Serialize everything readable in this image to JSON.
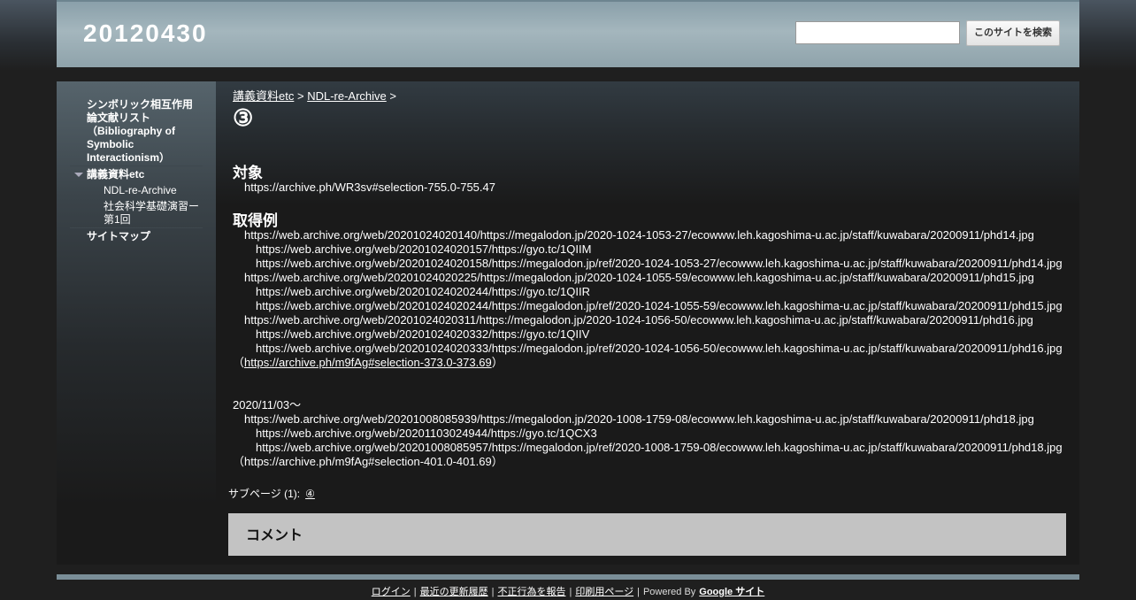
{
  "header": {
    "title": "20120430",
    "search_placeholder": "",
    "search_button": "このサイトを検索"
  },
  "sidebar": {
    "items": [
      {
        "label": "シンボリック相互作用論文献リスト（Bibliography of Symbolic Interactionism）"
      },
      {
        "label": "講義資料etc"
      },
      {
        "label": "NDL-re-Archive"
      },
      {
        "label": "社会科学基礎演習ー第1回"
      },
      {
        "label": "サイトマップ"
      }
    ]
  },
  "main": {
    "breadcrumb": {
      "link1": "講義資料etc",
      "sep1": ">",
      "link2": "NDL-re-Archive",
      "sep2": ">"
    },
    "title": "③",
    "section1": {
      "heading": "対象",
      "line": "https://archive.ph/WR3sv#selection-755.0-755.47"
    },
    "section2": {
      "heading": "取得例",
      "lines": [
        "https://web.archive.org/web/20201024020140/https://megalodon.jp/2020-1024-1053-27/ecowww.leh.kagoshima-u.ac.jp/staff/kuwabara/20200911/phd14.jpg",
        "https://web.archive.org/web/20201024020157/https://gyo.tc/1QIIM",
        "https://web.archive.org/web/20201024020158/https://megalodon.jp/ref/2020-1024-1053-27/ecowww.leh.kagoshima-u.ac.jp/staff/kuwabara/20200911/phd14.jpg",
        "https://web.archive.org/web/20201024020225/https://megalodon.jp/2020-1024-1055-59/ecowww.leh.kagoshima-u.ac.jp/staff/kuwabara/20200911/phd15.jpg",
        "https://web.archive.org/web/20201024020244/https://gyo.tc/1QIIR",
        "https://web.archive.org/web/20201024020244/https://megalodon.jp/ref/2020-1024-1055-59/ecowww.leh.kagoshima-u.ac.jp/staff/kuwabara/20200911/phd15.jpg",
        "https://web.archive.org/web/20201024020311/https://megalodon.jp/2020-1024-1056-50/ecowww.leh.kagoshima-u.ac.jp/staff/kuwabara/20200911/phd16.jpg",
        "https://web.archive.org/web/20201024020332/https://gyo.tc/1QIIV",
        "https://web.archive.org/web/20201024020333/https://megalodon.jp/ref/2020-1024-1056-50/ecowww.leh.kagoshima-u.ac.jp/staff/kuwabara/20200911/phd16.jpg"
      ],
      "source_open": "（",
      "source_link": "https://archive.ph/m9fAg#selection-373.0-373.69",
      "source_close": "）"
    },
    "section3": {
      "date": "2020/11/03～",
      "lines": [
        "https://web.archive.org/web/20201008085939/https://megalodon.jp/2020-1008-1759-08/ecowww.leh.kagoshima-u.ac.jp/staff/kuwabara/20200911/phd18.jpg",
        "https://web.archive.org/web/20201103024944/https://gyo.tc/1QCX3",
        "https://web.archive.org/web/20201008085957/https://megalodon.jp/ref/2020-1008-1759-08/ecowww.leh.kagoshima-u.ac.jp/staff/kuwabara/20200911/phd18.jpg"
      ],
      "source": "（https://archive.ph/m9fAg#selection-401.0-401.69）"
    },
    "subpages": {
      "label": "サブページ (1):",
      "link": "④"
    },
    "comment": {
      "title": "コメント"
    }
  },
  "footer": {
    "login": "ログイン",
    "recent": "最近の更新履歴",
    "report": "不正行為を報告",
    "print": "印刷用ページ",
    "powered": "Powered By",
    "google_sites": "Google サイト",
    "separator": "|"
  }
}
